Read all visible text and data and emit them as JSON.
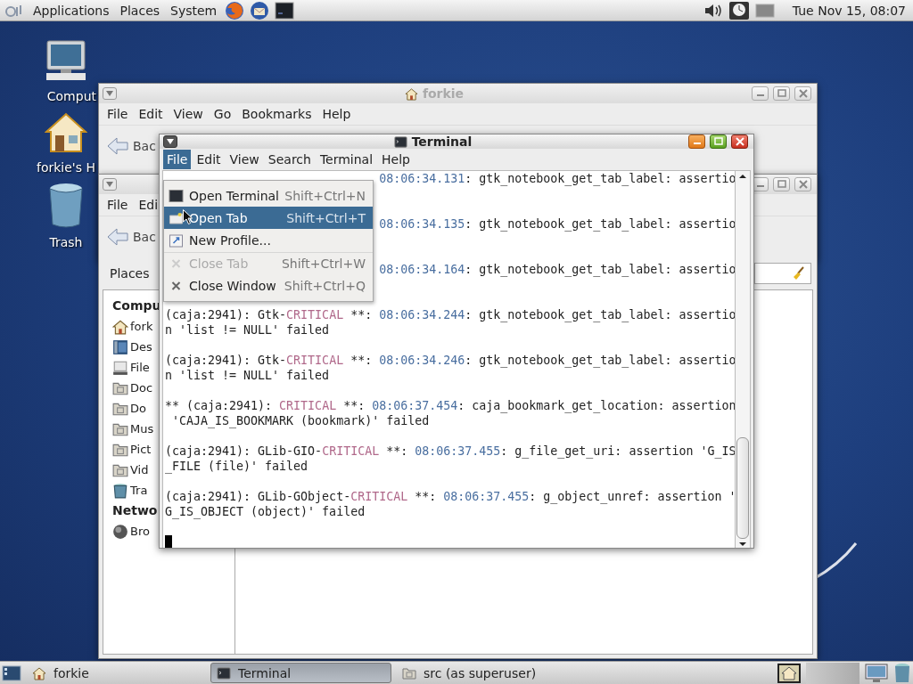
{
  "top_panel": {
    "menus": [
      "Applications",
      "Places",
      "System"
    ],
    "clock": "Tue Nov 15, 08:07"
  },
  "desktop_icons": [
    {
      "label": "Comput",
      "kind": "computer"
    },
    {
      "label": "forkie's H",
      "kind": "home"
    },
    {
      "label": "Trash",
      "kind": "trash"
    }
  ],
  "windows": [
    {
      "title": "forkie",
      "active": false,
      "menu": [
        "File",
        "Edit",
        "View",
        "Go",
        "Bookmarks",
        "Help"
      ],
      "back_button": "Bac"
    },
    {
      "active": false,
      "menu": [
        "File",
        "Edi"
      ],
      "back_button": "Bac",
      "sidebar": {
        "header": "Places",
        "sections": [
          {
            "title": "Compu",
            "items": [
              {
                "label": "fork",
                "kind": "home"
              },
              {
                "label": "Des",
                "kind": "desktop"
              },
              {
                "label": "File",
                "kind": "drive"
              },
              {
                "label": "Doc",
                "kind": "folder"
              },
              {
                "label": "Do",
                "kind": "folder"
              },
              {
                "label": "Mus",
                "kind": "folder"
              },
              {
                "label": "Pict",
                "kind": "folder"
              },
              {
                "label": "Vid",
                "kind": "folder"
              },
              {
                "label": "Tra",
                "kind": "trash"
              }
            ]
          },
          {
            "title": "Netwo",
            "items": [
              {
                "label": "Bro",
                "kind": "network"
              }
            ]
          }
        ]
      }
    }
  ],
  "terminal": {
    "title": "Terminal",
    "active": true,
    "menu": [
      {
        "label": "File",
        "selected": true
      },
      {
        "label": "Edit",
        "selected": false
      },
      {
        "label": "View",
        "selected": false
      },
      {
        "label": "Search",
        "selected": false
      },
      {
        "label": "Terminal",
        "selected": false
      },
      {
        "label": "Help",
        "selected": false
      }
    ],
    "file_menu": [
      {
        "label": "Open Terminal",
        "shortcut": "Shift+Ctrl+N",
        "kind": "terminal",
        "selected": false,
        "disabled": false,
        "separator_before": false
      },
      {
        "label": "Open Tab",
        "shortcut": "Shift+Ctrl+T",
        "kind": "tab",
        "selected": true,
        "disabled": false,
        "separator_before": false
      },
      {
        "label": "New Profile...",
        "kind": "profile",
        "selected": false,
        "disabled": false,
        "separator_before": false
      },
      {
        "label": "Close Tab",
        "shortcut": "Shift+Ctrl+W",
        "kind": "close",
        "selected": false,
        "disabled": true,
        "separator_before": true
      },
      {
        "label": "Close Window",
        "shortcut": "Shift+Ctrl+Q",
        "kind": "close",
        "selected": false,
        "disabled": false,
        "separator_before": false
      }
    ],
    "messages": [
      {
        "covered": true,
        "lines": [
          [
            {
              "kind": "time",
              "text": "08:06:34.131"
            },
            {
              "kind": "plain",
              "text": ": gtk_notebook_get_tab_label: assertio"
            }
          ]
        ]
      },
      {
        "covered": true,
        "lines": [
          [
            {
              "kind": "time",
              "text": "08:06:34.135"
            },
            {
              "kind": "plain",
              "text": ": gtk_notebook_get_tab_label: assertio"
            }
          ]
        ]
      },
      {
        "covered": true,
        "lines": [
          [
            {
              "kind": "time",
              "text": "08:06:34.164"
            },
            {
              "kind": "plain",
              "text": ": gtk_notebook_get_tab_label: assertio"
            }
          ]
        ]
      },
      {
        "covered": false,
        "lines": [
          [
            {
              "kind": "plain",
              "text": "(caja:2941): Gtk-"
            },
            {
              "kind": "critical",
              "text": "CRITICAL"
            },
            {
              "kind": "plain",
              "text": " **: "
            },
            {
              "kind": "time",
              "text": "08:06:34.244"
            },
            {
              "kind": "plain",
              "text": ": gtk_notebook_get_tab_label: assertio"
            }
          ],
          [
            {
              "kind": "plain",
              "text": "n 'list != NULL' failed"
            }
          ]
        ]
      },
      {
        "covered": false,
        "lines": [
          [
            {
              "kind": "plain",
              "text": "(caja:2941): Gtk-"
            },
            {
              "kind": "critical",
              "text": "CRITICAL"
            },
            {
              "kind": "plain",
              "text": " **: "
            },
            {
              "kind": "time",
              "text": "08:06:34.246"
            },
            {
              "kind": "plain",
              "text": ": gtk_notebook_get_tab_label: assertio"
            }
          ],
          [
            {
              "kind": "plain",
              "text": "n 'list != NULL' failed"
            }
          ]
        ]
      },
      {
        "covered": false,
        "lines": [
          [
            {
              "kind": "plain",
              "text": "** (caja:2941): "
            },
            {
              "kind": "critical",
              "text": "CRITICAL"
            },
            {
              "kind": "plain",
              "text": " **: "
            },
            {
              "kind": "time",
              "text": "08:06:37.454"
            },
            {
              "kind": "plain",
              "text": ": caja_bookmark_get_location: assertion"
            }
          ],
          [
            {
              "kind": "plain",
              "text": " 'CAJA_IS_BOOKMARK (bookmark)' failed"
            }
          ]
        ]
      },
      {
        "covered": false,
        "lines": [
          [
            {
              "kind": "plain",
              "text": "(caja:2941): GLib-GIO-"
            },
            {
              "kind": "critical",
              "text": "CRITICAL"
            },
            {
              "kind": "plain",
              "text": " **: "
            },
            {
              "kind": "time",
              "text": "08:06:37.455"
            },
            {
              "kind": "plain",
              "text": ": g_file_get_uri: assertion 'G_IS"
            }
          ],
          [
            {
              "kind": "plain",
              "text": "_FILE (file)' failed"
            }
          ]
        ]
      },
      {
        "covered": false,
        "lines": [
          [
            {
              "kind": "plain",
              "text": "(caja:2941): GLib-GObject-"
            },
            {
              "kind": "critical",
              "text": "CRITICAL"
            },
            {
              "kind": "plain",
              "text": " **: "
            },
            {
              "kind": "time",
              "text": "08:06:37.455"
            },
            {
              "kind": "plain",
              "text": ": g_object_unref: assertion '"
            }
          ],
          [
            {
              "kind": "plain",
              "text": "G_IS_OBJECT (object)' failed"
            }
          ]
        ]
      }
    ]
  },
  "taskbar": {
    "tasks": [
      {
        "label": "forkie",
        "kind": "home",
        "selected": false
      },
      {
        "label": "Terminal",
        "kind": "terminal",
        "selected": true
      },
      {
        "label": "src (as superuser)",
        "kind": "folder",
        "selected": false
      }
    ]
  }
}
